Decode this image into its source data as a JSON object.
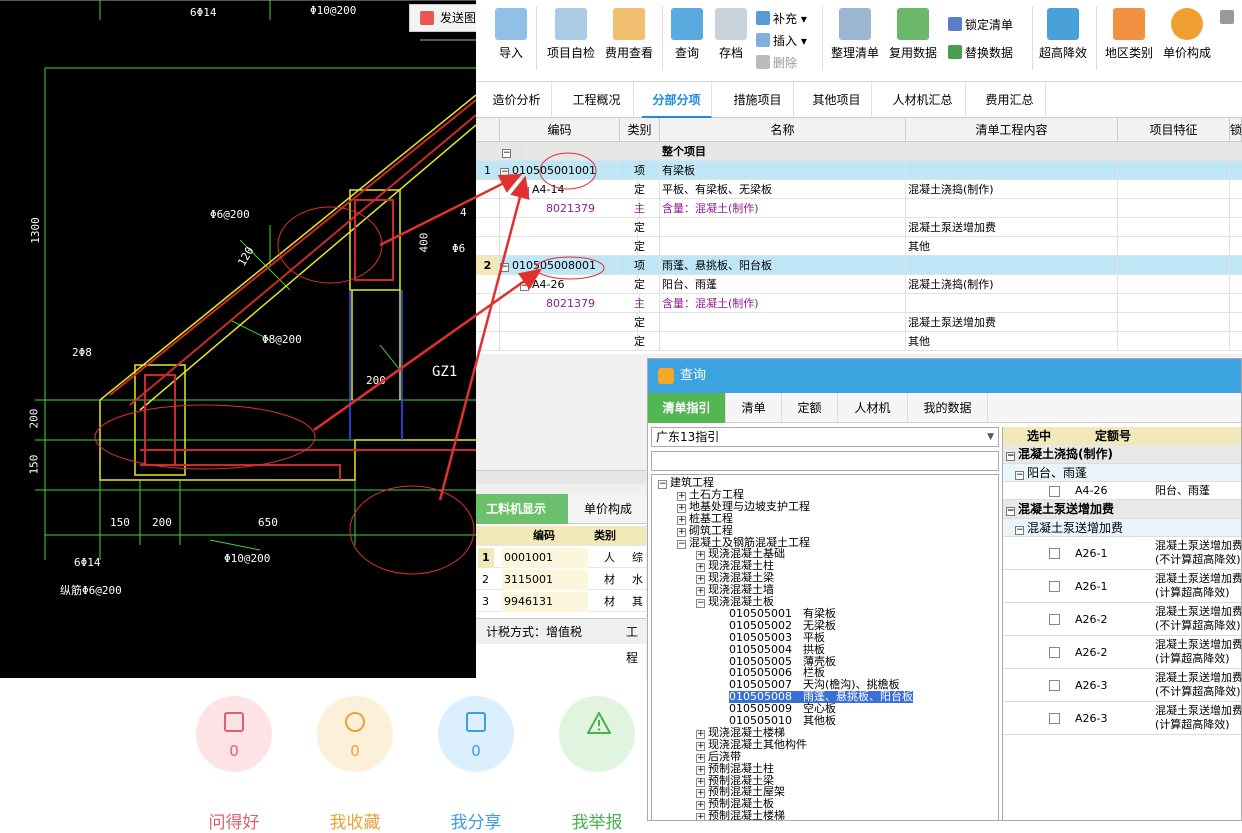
{
  "cad": {
    "send_button": "发送图",
    "texts": [
      "6Φ14",
      "Φ10@200",
      "Φ6@200",
      "120",
      "Φ8@200",
      "2Φ8",
      "400",
      "Φ6",
      "4",
      "200",
      "GZ1",
      "1300",
      "200",
      "150",
      "150",
      "200",
      "650",
      "6Φ14",
      "Φ10@200",
      "纵筋Φ6@200"
    ]
  },
  "ribbon": {
    "buttons": [
      "导入",
      "项目自检",
      "费用查看",
      "查询",
      "存档",
      "整理清单",
      "复用数据",
      "超高降效",
      "地区类别",
      "单价构成"
    ],
    "small": [
      "补充",
      "插入",
      "删除",
      "锁定清单",
      "替换数据"
    ],
    "colors": {
      "accent": "#1d8ddb"
    }
  },
  "tabs": [
    "造价分析",
    "工程概况",
    "分部分项",
    "措施项目",
    "其他项目",
    "人材机汇总",
    "费用汇总"
  ],
  "active_tab": "分部分项",
  "grid": {
    "headers": [
      "编码",
      "类别",
      "名称",
      "清单工程内容",
      "项目特征",
      "锁"
    ],
    "group_label": "整个项目",
    "rows": [
      {
        "no": "1",
        "code": "010505001001",
        "type": "项",
        "name": "有梁板",
        "content": ""
      },
      {
        "no": "",
        "code": "A4-14",
        "type": "定",
        "name": "平板、有梁板、无梁板",
        "content": "混凝土浇捣(制作)"
      },
      {
        "no": "",
        "code": "8021379",
        "type": "主",
        "name": "含量：混凝土(制作)",
        "content": ""
      },
      {
        "no": "",
        "code": "",
        "type": "定",
        "name": "",
        "content": "混凝土泵送增加费"
      },
      {
        "no": "",
        "code": "",
        "type": "定",
        "name": "",
        "content": "其他"
      },
      {
        "no": "2",
        "code": "010505008001",
        "type": "项",
        "name": "雨蓬、悬挑板、阳台板",
        "content": ""
      },
      {
        "no": "",
        "code": "A4-26",
        "type": "定",
        "name": "阳台、雨蓬",
        "content": "混凝土浇捣(制作)"
      },
      {
        "no": "",
        "code": "8021379",
        "type": "主",
        "name": "含量：混凝土(制作)",
        "content": ""
      },
      {
        "no": "",
        "code": "",
        "type": "定",
        "name": "",
        "content": "混凝土泵送增加费"
      },
      {
        "no": "",
        "code": "",
        "type": "定",
        "name": "",
        "content": "其他"
      }
    ]
  },
  "lower": {
    "tabs": [
      "工料机显示",
      "单价构成"
    ],
    "headers": [
      "编码",
      "类别"
    ],
    "rows": [
      {
        "no": "1",
        "code": "0001001",
        "type": "人",
        "extra": "综"
      },
      {
        "no": "2",
        "code": "3115001",
        "type": "材",
        "extra": "水"
      },
      {
        "no": "3",
        "code": "9946131",
        "type": "材",
        "extra": "其"
      }
    ],
    "status": "计税方式：增值税",
    "status2": "工程"
  },
  "dialog": {
    "title": "查询",
    "tabs": [
      "清单指引",
      "清单",
      "定额",
      "人材机",
      "我的数据"
    ],
    "combo": "广东13指引",
    "tree": [
      {
        "t": "建筑工程",
        "lv": 0,
        "box": "−"
      },
      {
        "t": "土石方工程",
        "lv": 1,
        "box": "+"
      },
      {
        "t": "地基处理与边坡支护工程",
        "lv": 1,
        "box": "+"
      },
      {
        "t": "桩基工程",
        "lv": 1,
        "box": "+"
      },
      {
        "t": "砌筑工程",
        "lv": 1,
        "box": "+"
      },
      {
        "t": "混凝土及钢筋混凝土工程",
        "lv": 1,
        "box": "−"
      },
      {
        "t": "现浇混凝土基础",
        "lv": 2,
        "box": "+"
      },
      {
        "t": "现浇混凝土柱",
        "lv": 2,
        "box": "+"
      },
      {
        "t": "现浇混凝土梁",
        "lv": 2,
        "box": "+"
      },
      {
        "t": "现浇混凝土墙",
        "lv": 2,
        "box": "+"
      },
      {
        "t": "现浇混凝土板",
        "lv": 2,
        "box": "−"
      },
      {
        "t": "010505001　有梁板",
        "lv": 3,
        "box": ""
      },
      {
        "t": "010505002　无梁板",
        "lv": 3,
        "box": ""
      },
      {
        "t": "010505003　平板",
        "lv": 3,
        "box": ""
      },
      {
        "t": "010505004　拱板",
        "lv": 3,
        "box": ""
      },
      {
        "t": "010505005　薄壳板",
        "lv": 3,
        "box": ""
      },
      {
        "t": "010505006　栏板",
        "lv": 3,
        "box": ""
      },
      {
        "t": "010505007　天沟(檐沟)、挑檐板",
        "lv": 3,
        "box": ""
      },
      {
        "t": "010505008　雨蓬、悬挑板、阳台板",
        "lv": 3,
        "box": "",
        "sel": true
      },
      {
        "t": "010505009　空心板",
        "lv": 3,
        "box": ""
      },
      {
        "t": "010505010　其他板",
        "lv": 3,
        "box": ""
      },
      {
        "t": "现浇混凝土楼梯",
        "lv": 2,
        "box": "+"
      },
      {
        "t": "现浇混凝土其他构件",
        "lv": 2,
        "box": "+"
      },
      {
        "t": "后浇带",
        "lv": 2,
        "box": "+"
      },
      {
        "t": "预制混凝土柱",
        "lv": 2,
        "box": "+"
      },
      {
        "t": "预制混凝土梁",
        "lv": 2,
        "box": "+"
      },
      {
        "t": "预制混凝土屋架",
        "lv": 2,
        "box": "+"
      },
      {
        "t": "预制混凝土板",
        "lv": 2,
        "box": "+"
      },
      {
        "t": "预制混凝土楼梯",
        "lv": 2,
        "box": "+"
      }
    ],
    "right_headers": [
      "选中",
      "定额号"
    ],
    "right_groups": [
      {
        "title": "混凝土浇捣(制作)",
        "sub": "阳台、雨蓬",
        "rows": [
          {
            "code": "A4-26",
            "desc": "阳台、雨蓬"
          }
        ]
      },
      {
        "title": "混凝土泵送增加费",
        "sub": "混凝土泵送增加费",
        "rows": [
          {
            "code": "A26-1",
            "desc": "混凝土泵送增加费(不计算超高降效)"
          },
          {
            "code": "A26-1",
            "desc": "混凝土泵送增加费(计算超高降效)"
          },
          {
            "code": "A26-2",
            "desc": "混凝土泵送增加费(不计算超高降效)"
          },
          {
            "code": "A26-2",
            "desc": "混凝土泵送增加费(计算超高降效)"
          },
          {
            "code": "A26-3",
            "desc": "混凝土泵送增加费(不计算超高降效)"
          },
          {
            "code": "A26-3",
            "desc": "混凝土泵送增加费(计算超高降效)"
          }
        ]
      }
    ]
  },
  "actions": [
    {
      "label": "问得好",
      "count": "0",
      "color": "#e06070",
      "bg": "#fde3e6"
    },
    {
      "label": "我收藏",
      "count": "0",
      "color": "#e8a43a",
      "bg": "#fdf0d9"
    },
    {
      "label": "我分享",
      "count": "0",
      "color": "#3a9ee0",
      "bg": "#dcefff"
    },
    {
      "label": "我举报",
      "count": "",
      "color": "#4caf50",
      "bg": "#e0f4e0"
    }
  ]
}
